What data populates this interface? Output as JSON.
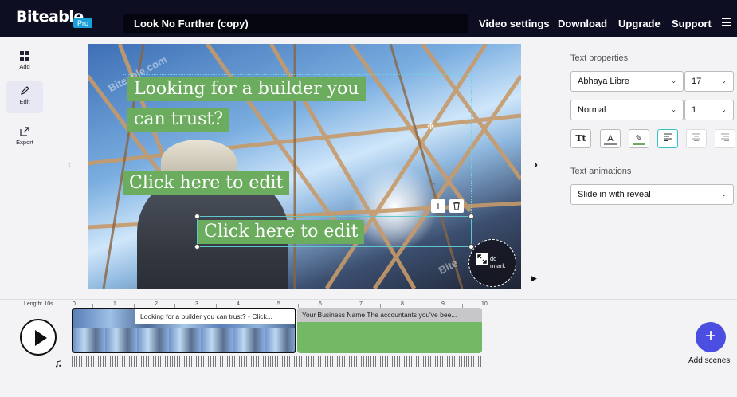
{
  "header": {
    "logo": "Biteable",
    "badge": "Pro",
    "project_title": "Look No Further (copy)",
    "nav": [
      "Video settings",
      "Download",
      "Upgrade",
      "Support"
    ]
  },
  "rail": {
    "items": [
      {
        "label": "Add",
        "icon": "grid-icon"
      },
      {
        "label": "Edit",
        "icon": "pencil-icon"
      },
      {
        "label": "Export",
        "icon": "export-icon"
      }
    ]
  },
  "canvas": {
    "captions": [
      "Looking for a builder you",
      "can trust?",
      "Click here to edit",
      "Click here to edit"
    ],
    "watermark_text": "Biteable.com",
    "watermark_text_small": "Bite",
    "add_watermark_label": "Add watermark",
    "add_watermark_visible": "dd\nrmark"
  },
  "panel": {
    "text_properties_heading": "Text properties",
    "font_family": "Abhaya Libre",
    "font_size": "17",
    "font_weight": "Normal",
    "line_spacing": "1",
    "tools": [
      "Tt",
      "A",
      "highlight",
      "align-left",
      "align-center",
      "align-right"
    ],
    "text_animations_heading": "Text animations",
    "animation": "Slide in with reveal"
  },
  "timeline": {
    "length_label": "Length: 10s",
    "ruler": [
      "0",
      "1",
      "2",
      "3",
      "4",
      "5",
      "6",
      "7",
      "8",
      "9",
      "10"
    ],
    "scenes": [
      {
        "label": "Looking for a builder you can trust? - Click..."
      },
      {
        "label": "Your Business Name The accountants you've bee..."
      }
    ],
    "add_scenes_label": "Add scenes",
    "colors": {
      "accent": "#4b4ee0",
      "caption_green": "#6bac5f",
      "selection": "#5fc6c9"
    }
  }
}
